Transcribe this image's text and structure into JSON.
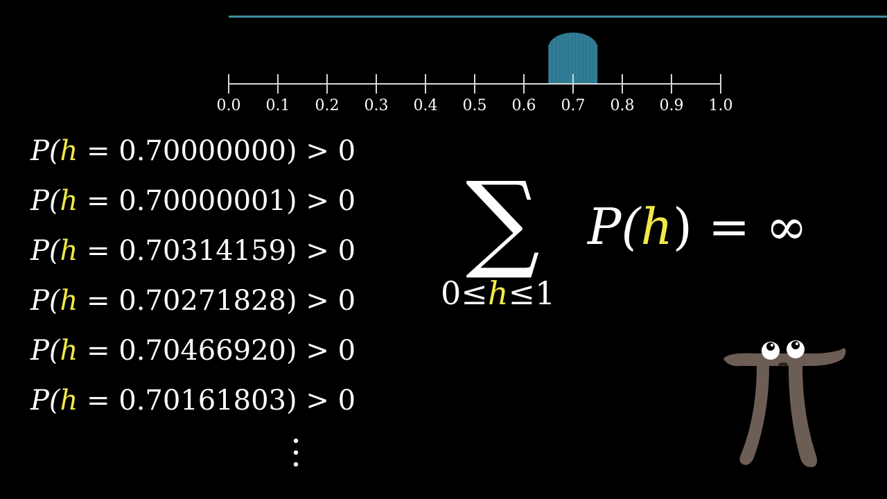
{
  "number_line": {
    "ticks": [
      "0.0",
      "0.1",
      "0.2",
      "0.3",
      "0.4",
      "0.5",
      "0.6",
      "0.7",
      "0.8",
      "0.9",
      "1.0"
    ],
    "range": [
      0.0,
      1.0
    ],
    "density": {
      "from": 0.65,
      "to": 0.75,
      "peak": 0.7,
      "color": "#3b9ab8"
    },
    "top_line_color": "#58c4dd"
  },
  "probabilities": [
    {
      "lhs": "P(",
      "var": "h",
      "eq": " = ",
      "value": "0.70000000",
      "rhs": ") > 0"
    },
    {
      "lhs": "P(",
      "var": "h",
      "eq": " = ",
      "value": "0.70000001",
      "rhs": ") > 0"
    },
    {
      "lhs": "P(",
      "var": "h",
      "eq": " = ",
      "value": "0.70314159",
      "rhs": ") > 0"
    },
    {
      "lhs": "P(",
      "var": "h",
      "eq": " = ",
      "value": "0.70271828",
      "rhs": ") > 0"
    },
    {
      "lhs": "P(",
      "var": "h",
      "eq": " = ",
      "value": "0.70466920",
      "rhs": ") > 0"
    },
    {
      "lhs": "P(",
      "var": "h",
      "eq": " = ",
      "value": "0.70161803",
      "rhs": ") > 0"
    }
  ],
  "vdots": "⋮",
  "sum": {
    "symbol": "∑",
    "lower_left": "0≤",
    "lower_var": "h",
    "lower_right": "≤1",
    "p": "P(",
    "var": "h",
    "rest": ") = ∞"
  },
  "colors": {
    "highlight": "#f0ea48",
    "pi_creature": "#6d5e55",
    "text": "#ffffff"
  },
  "pi_creature": {
    "icon": "pi-creature-icon"
  }
}
